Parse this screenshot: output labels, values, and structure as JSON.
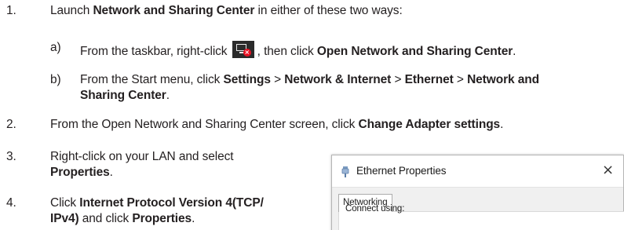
{
  "steps": [
    {
      "num": "1.",
      "parts": [
        {
          "t": "Launch "
        },
        {
          "t": "Network and Sharing Center",
          "b": true
        },
        {
          "t": " in either of these two ways:"
        }
      ]
    },
    {
      "num": "2.",
      "parts": [
        {
          "t": "From the Open Network and Sharing Center screen, click "
        },
        {
          "t": "Change Adapter settings",
          "b": true
        },
        {
          "t": "."
        }
      ]
    },
    {
      "num": "3.",
      "line1": "Right-click on your LAN and select",
      "line2": "Properties",
      "line2_suffix": "."
    },
    {
      "num": "4.",
      "line1": [
        {
          "t": "Click "
        },
        {
          "t": "Internet Protocol Version 4(TCP/",
          "b": true
        }
      ],
      "line2": [
        {
          "t": "IPv4)",
          "b": true
        },
        {
          "t": " and click "
        },
        {
          "t": "Properties",
          "b": true
        },
        {
          "t": "."
        }
      ]
    }
  ],
  "substeps": {
    "a": {
      "letter": "a)",
      "before_icon": "From the taskbar, right-click ",
      "icon": "network-disconnected-icon",
      "after_icon": ", then click ",
      "bold": "Open Network and Sharing Center",
      "end": "."
    },
    "b": {
      "letter": "b)",
      "line1": [
        {
          "t": "From the Start menu, click "
        },
        {
          "t": "Settings",
          "b": true
        },
        {
          "t": " > "
        },
        {
          "t": "Network & Internet",
          "b": true
        },
        {
          "t": " > "
        },
        {
          "t": "Ethernet",
          "b": true
        },
        {
          "t": " > "
        },
        {
          "t": "Network and",
          "b": true
        }
      ],
      "line2": [
        {
          "t": "Sharing Center",
          "b": true
        },
        {
          "t": "."
        }
      ]
    }
  },
  "dialog": {
    "title": "Ethernet Properties",
    "close": "×",
    "tab": "Networking",
    "connect_label": "Connect using:",
    "icon": "ethernet-plug-icon"
  },
  "colors": {
    "text": "#231f20",
    "badge_red": "#e81123",
    "taskbar": "#2b2b2b"
  }
}
